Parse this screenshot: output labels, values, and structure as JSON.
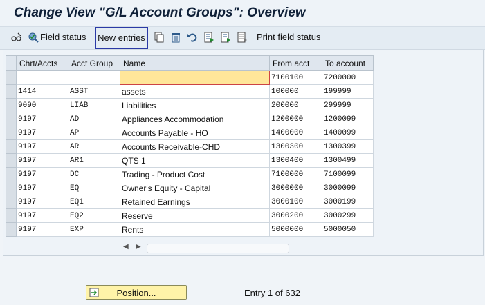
{
  "window": {
    "title": "Change View \"G/L Account Groups\": Overview"
  },
  "toolbar": {
    "field_status": "Field status",
    "new_entries": "New entries",
    "print_field_status": "Print field status"
  },
  "table": {
    "columns": [
      "Chrt/Accts",
      "Acct Group",
      "Name",
      "From acct",
      "To account"
    ],
    "rows": [
      [
        "",
        "",
        "",
        "7100100",
        "7200000"
      ],
      [
        "1414",
        "ASST",
        "assets",
        "100000",
        "199999"
      ],
      [
        "9090",
        "LIAB",
        "Liabilities",
        "200000",
        "299999"
      ],
      [
        "9197",
        "AD",
        "Appliances Accommodation",
        "1200000",
        "1200099"
      ],
      [
        "9197",
        "AP",
        "Accounts Payable - HO",
        "1400000",
        "1400099"
      ],
      [
        "9197",
        "AR",
        "Accounts Receivable-CHD",
        "1300300",
        "1300399"
      ],
      [
        "9197",
        "AR1",
        "QTS 1",
        "1300400",
        "1300499"
      ],
      [
        "9197",
        "DC",
        "Trading - Product Cost",
        "7100000",
        "7100099"
      ],
      [
        "9197",
        "EQ",
        "Owner's Equity - Capital",
        "3000000",
        "3000099"
      ],
      [
        "9197",
        "EQ1",
        "Retained Earnings",
        "3000100",
        "3000199"
      ],
      [
        "9197",
        "EQ2",
        "Reserve",
        "3000200",
        "3000299"
      ],
      [
        "9197",
        "EXP",
        "Rents",
        "5000000",
        "5000050"
      ]
    ]
  },
  "footer": {
    "position_label": "Position...",
    "entry_text": "Entry 1 of 632"
  }
}
